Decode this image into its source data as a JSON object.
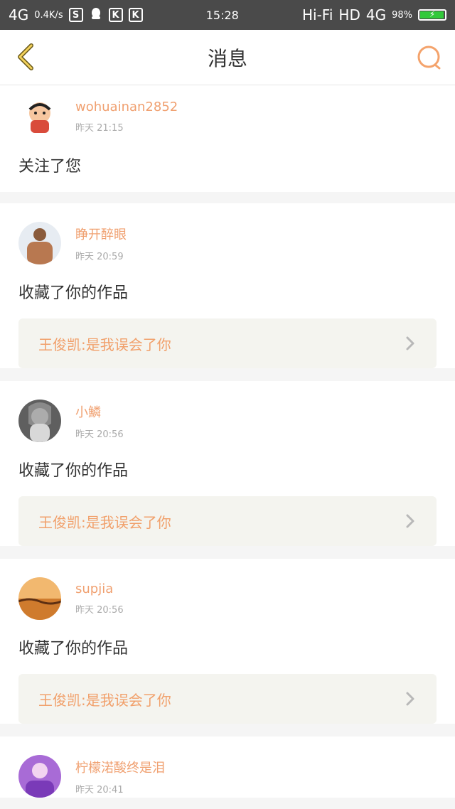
{
  "status_bar": {
    "network_left": "4G",
    "speed": "0.4K/s",
    "icons": [
      "s-icon",
      "qq-icon",
      "k-icon",
      "k-icon"
    ],
    "time": "15:28",
    "hifi": "Hi-Fi",
    "hd": "HD",
    "network_right": "4G",
    "battery_pct": "98%"
  },
  "header": {
    "title": "消息"
  },
  "messages": [
    {
      "name": "wohuainan2852",
      "time": "昨天 21:15",
      "action": "关注了您",
      "work": ""
    },
    {
      "name": "睁开醉眼",
      "time": "昨天 20:59",
      "action": "收藏了你的作品",
      "work": "王俊凯:是我误会了你"
    },
    {
      "name": "小鱗",
      "time": "昨天 20:56",
      "action": "收藏了你的作品",
      "work": "王俊凯:是我误会了你"
    },
    {
      "name": "supjia",
      "time": "昨天 20:56",
      "action": "收藏了你的作品",
      "work": "王俊凯:是我误会了你"
    },
    {
      "name": "柠檬渃酸终是泪",
      "time": "昨天 20:41",
      "action": "",
      "work": ""
    }
  ],
  "colors": {
    "accent": "#f0a070",
    "battery": "#31c93a"
  }
}
